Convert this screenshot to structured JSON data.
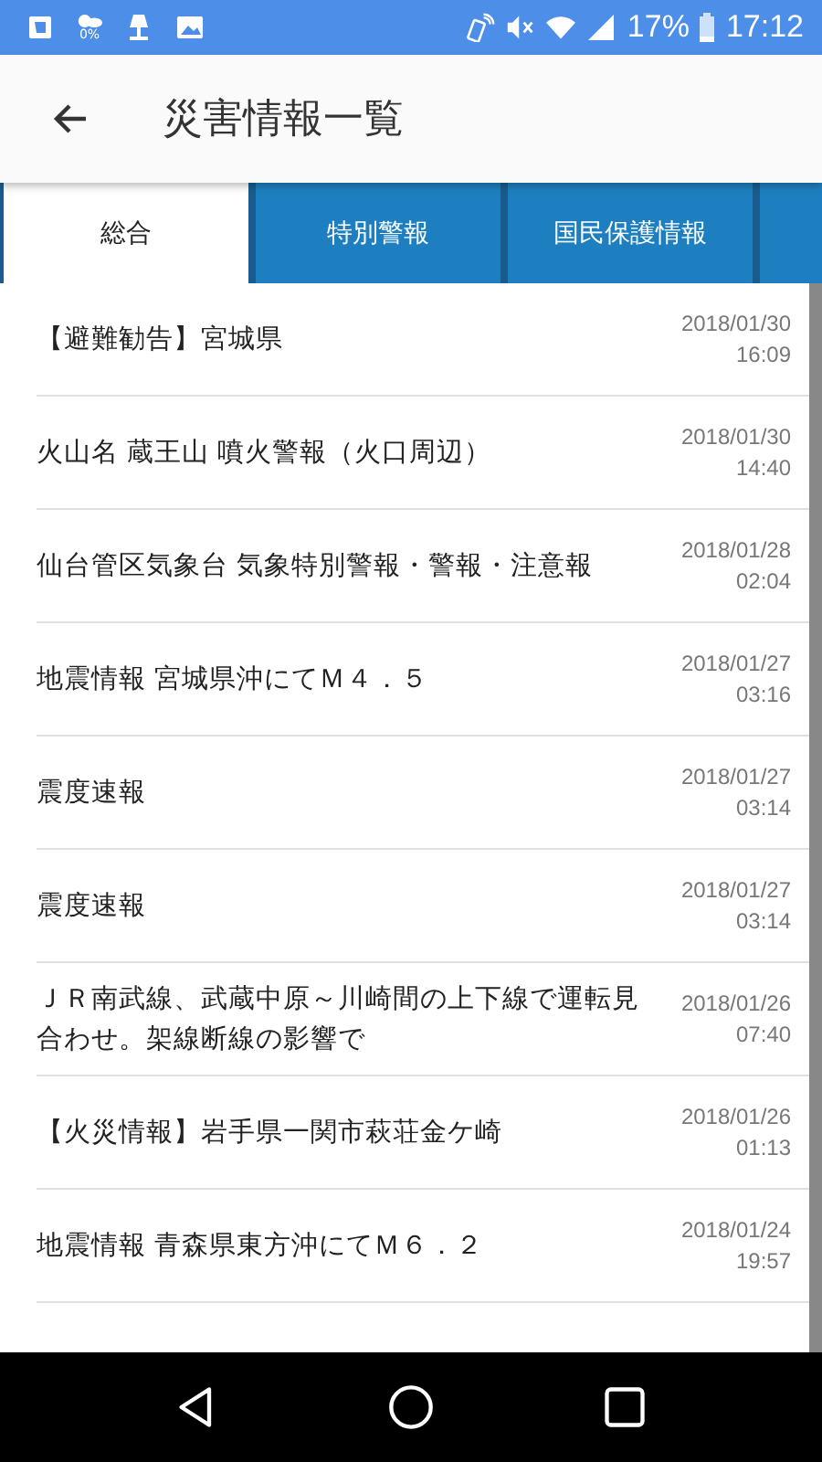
{
  "status_bar": {
    "weather_reading": "0%",
    "battery": "17%",
    "time": "17:12"
  },
  "app_bar": {
    "title": "災害情報一覧"
  },
  "tabs": [
    {
      "label": "総合",
      "selected": true
    },
    {
      "label": "特別警報",
      "selected": false
    },
    {
      "label": "国民保護情報",
      "selected": false
    },
    {
      "selected": false
    }
  ],
  "items": [
    {
      "title": "【避難勧告】宮城県",
      "date": "2018/01/30",
      "time": "16:09"
    },
    {
      "title": "火山名 蔵王山 噴火警報（火口周辺）",
      "date": "2018/01/30",
      "time": "14:40"
    },
    {
      "title": "仙台管区気象台 気象特別警報・警報・注意報",
      "date": "2018/01/28",
      "time": "02:04"
    },
    {
      "title": "地震情報 宮城県沖にてＭ４．５",
      "date": "2018/01/27",
      "time": "03:16"
    },
    {
      "title": "震度速報",
      "date": "2018/01/27",
      "time": "03:14"
    },
    {
      "title": "震度速報",
      "date": "2018/01/27",
      "time": "03:14"
    },
    {
      "title": "ＪＲ南武線、武蔵中原～川崎間の上下線で運転見合わせ。架線断線の影響で",
      "date": "2018/01/26",
      "time": "07:40"
    },
    {
      "title": "【火災情報】岩手県一関市萩荘金ケ崎",
      "date": "2018/01/26",
      "time": "01:13"
    },
    {
      "title": "地震情報 青森県東方沖にてＭ６．２",
      "date": "2018/01/24",
      "time": "19:57"
    }
  ]
}
